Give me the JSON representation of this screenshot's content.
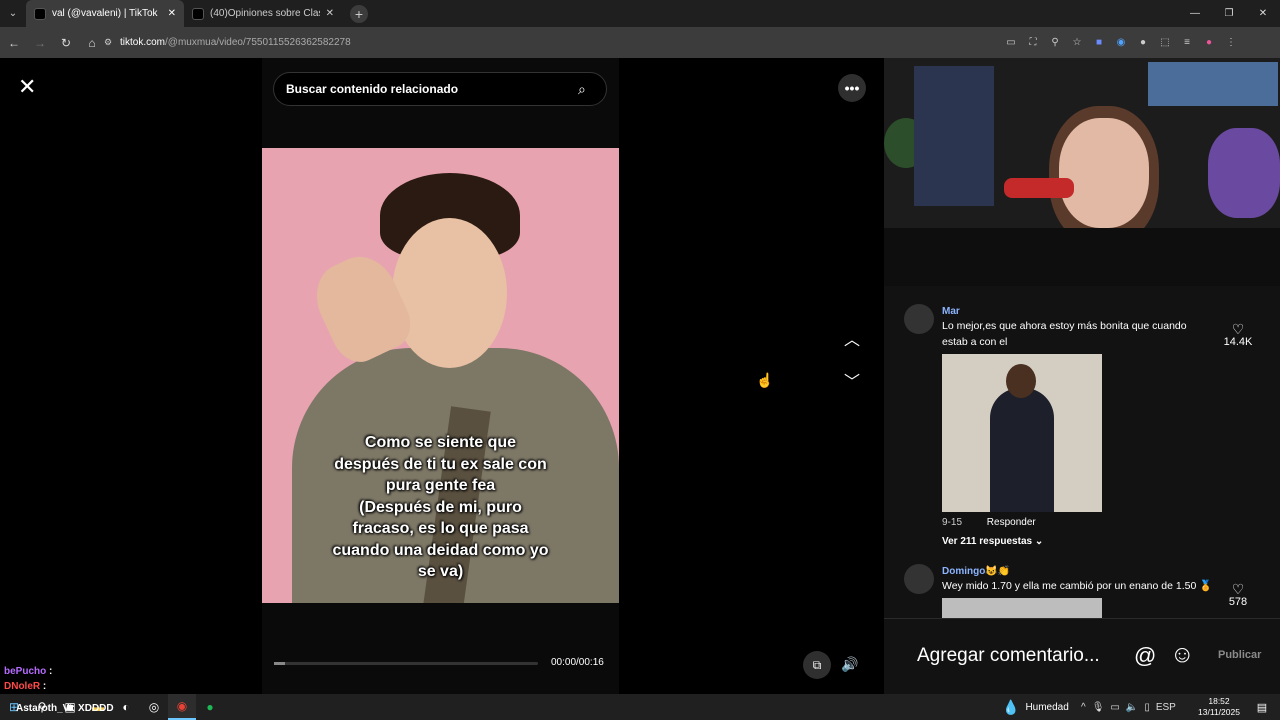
{
  "browser": {
    "tabs": [
      {
        "title": "val (@vavaleni) | TikTok",
        "active": true
      },
      {
        "title": "(40)Opiniones sobre Clash Roya",
        "active": false
      }
    ],
    "url_host": "tiktok.com",
    "url_path": "/@muxmua/video/7550115526362582278"
  },
  "viewer": {
    "search_placeholder": "Buscar contenido relacionado",
    "caption_lines": [
      "Como se siente que",
      "después de ti tu ex sale con",
      "pura gente fea",
      "(Después de mi, puro",
      "fracaso, es lo que pasa",
      "cuando una deidad como yo",
      "se va)"
    ],
    "time": "00:00/00:16",
    "progress": 0.04
  },
  "comments": [
    {
      "user": "Mar",
      "text": "Lo mejor,es que ahora estoy más bonita que cuando estab a con el",
      "likes": "14.4K",
      "date": "9-15",
      "reply_label": "Responder",
      "view_replies": "Ver 211 respuestas"
    },
    {
      "user": "Domingo😺👏",
      "text": "Wey mido 1.70 y ella me cambió por un enano de 1.50 🏅",
      "likes": "578"
    }
  ],
  "comment_bar": {
    "placeholder": "Agregar comentario...",
    "publish": "Publicar"
  },
  "chat": [
    {
      "user": "bePucho",
      "sep": ":"
    },
    {
      "user": "DNoleR",
      "sep": ":"
    }
  ],
  "taskbar": {
    "overlay_text": "Astaroth_Vi: XDDDD",
    "weather": "Humedad",
    "lang": "ESP",
    "time": "18:52",
    "date": "13/11/2025"
  },
  "colors": {
    "username": "#8cb4ff",
    "accent_taskbar": "#6cc6ff"
  }
}
